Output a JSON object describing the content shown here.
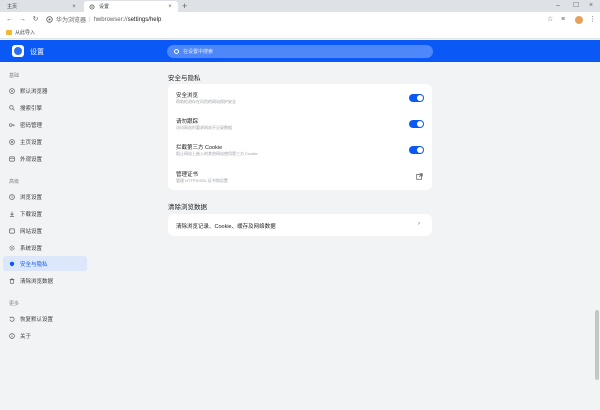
{
  "browser": {
    "tabs": [
      {
        "title": "主页",
        "close": "×"
      },
      {
        "title": "设置",
        "close": "×"
      }
    ],
    "new_tab": "+",
    "window_controls": [
      "–",
      "☐",
      "×"
    ],
    "nav": {
      "back": "←",
      "forward": "→",
      "reload": "↻"
    },
    "address": {
      "brand": "华为浏览器",
      "scheme": "hwbrowser://",
      "path": "settings/help"
    },
    "toolbar_right": {
      "star": "☆",
      "reading": "≡",
      "menu": "⋮"
    },
    "bookmarks": [
      {
        "label": "从此导入",
        "icon": "folder-icon"
      }
    ]
  },
  "header": {
    "title": "设置",
    "search_placeholder": "在设置中搜索",
    "bg_color": "#0a59f7"
  },
  "sidebar": {
    "groups": [
      {
        "label": "基础",
        "items": [
          {
            "label": "默认浏览器",
            "icon": "browser-icon"
          },
          {
            "label": "搜索引擎",
            "icon": "search-engine-icon"
          },
          {
            "label": "密码管理",
            "icon": "key-icon"
          },
          {
            "label": "主页设置",
            "icon": "home-icon"
          },
          {
            "label": "外观设置",
            "icon": "appearance-icon"
          }
        ]
      },
      {
        "label": "高级",
        "items": [
          {
            "label": "浏览设置",
            "icon": "browse-icon"
          },
          {
            "label": "下载设置",
            "icon": "download-icon"
          },
          {
            "label": "网站设置",
            "icon": "site-icon"
          },
          {
            "label": "系统设置",
            "icon": "system-icon"
          },
          {
            "label": "安全与隐私",
            "icon": "shield-icon",
            "active": true
          },
          {
            "label": "清除浏览数据",
            "icon": "trash-icon"
          }
        ]
      },
      {
        "label": "更多",
        "items": [
          {
            "label": "恢复默认设置",
            "icon": "restore-icon"
          },
          {
            "label": "关于",
            "icon": "info-icon"
          }
        ]
      }
    ]
  },
  "main": {
    "security": {
      "title": "安全与隐私",
      "rows": [
        {
          "title": "安全浏览",
          "desc": "帮助检测存在风险的网站保护安全",
          "toggle": "on"
        },
        {
          "title": "请勿跟踪",
          "desc": "访问网站时要求网站不记录数据",
          "toggle": "on"
        },
        {
          "title": "拦截第三方 Cookie",
          "desc": "阻止网站上嵌入的其他网站使用第三方 Cookie",
          "toggle": "on"
        },
        {
          "title": "管理证书",
          "desc": "管理 HTTPS/SSL 证书和设置"
        }
      ]
    },
    "clear": {
      "title": "清除浏览数据",
      "row": {
        "title": "清除浏览记录、Cookie、缓存及网络数据",
        "chevron": "›"
      }
    }
  }
}
